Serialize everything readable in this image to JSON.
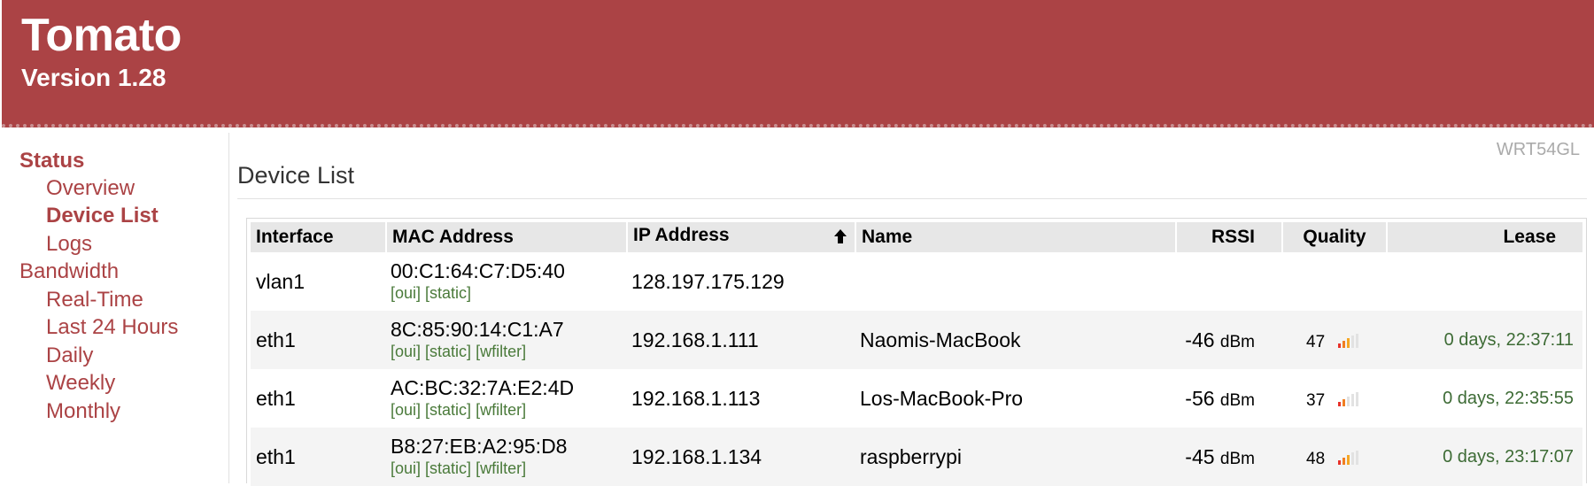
{
  "header": {
    "title": "Tomato",
    "version": "Version 1.28"
  },
  "router_model": "WRT54GL",
  "sidebar": {
    "sections": [
      {
        "label": "Status",
        "items": [
          "Overview",
          "Device List",
          "Logs"
        ]
      },
      {
        "label": "Bandwidth",
        "items": [
          "Real-Time",
          "Last 24 Hours",
          "Daily",
          "Weekly",
          "Monthly"
        ]
      }
    ],
    "active_item": "Device List"
  },
  "page": {
    "title": "Device List"
  },
  "table": {
    "columns": [
      "Interface",
      "MAC Address",
      "IP Address",
      "Name",
      "RSSI",
      "Quality",
      "Lease"
    ],
    "sort_column": "IP Address",
    "rows": [
      {
        "interface": "vlan1",
        "mac": "00:C1:64:C7:D5:40",
        "links": [
          "[oui]",
          "[static]"
        ],
        "ip": "128.197.175.129",
        "name": "",
        "rssi": "",
        "rssi_unit": "",
        "quality": "",
        "quality_level": 0,
        "lease": ""
      },
      {
        "interface": "eth1",
        "mac": "8C:85:90:14:C1:A7",
        "links": [
          "[oui]",
          "[static]",
          "[wfilter]"
        ],
        "ip": "192.168.1.111",
        "name": "Naomis-MacBook",
        "rssi": "-46",
        "rssi_unit": "dBm",
        "quality": "47",
        "quality_level": 3,
        "lease": "0 days, 22:37:11"
      },
      {
        "interface": "eth1",
        "mac": "AC:BC:32:7A:E2:4D",
        "links": [
          "[oui]",
          "[static]",
          "[wfilter]"
        ],
        "ip": "192.168.1.113",
        "name": "Los-MacBook-Pro",
        "rssi": "-56",
        "rssi_unit": "dBm",
        "quality": "37",
        "quality_level": 2,
        "lease": "0 days, 22:35:55"
      },
      {
        "interface": "eth1",
        "mac": "B8:27:EB:A2:95:D8",
        "links": [
          "[oui]",
          "[static]",
          "[wfilter]"
        ],
        "ip": "192.168.1.134",
        "name": "raspberrypi",
        "rssi": "-45",
        "rssi_unit": "dBm",
        "quality": "48",
        "quality_level": 3,
        "lease": "0 days, 23:17:07"
      }
    ]
  },
  "colors": {
    "brand": "#ab4345",
    "link_green": "#4a7a3a",
    "lease_green": "#3d6b35",
    "header_bg": "#e7e7e7"
  },
  "icons": {
    "sort": "sort-up-arrow-icon",
    "signal": "signal-bars-icon"
  }
}
